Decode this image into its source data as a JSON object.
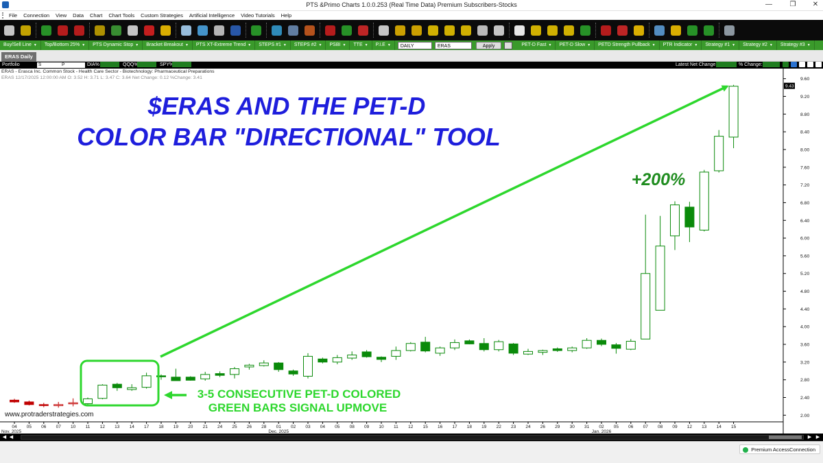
{
  "window": {
    "title": "PTS &Primo Charts 1.0.0.253  (Real Time Data) Premium Subscribers-Stocks",
    "minimize": "—",
    "maximize": "❐",
    "close": "✕"
  },
  "menu": [
    "File",
    "Connection",
    "View",
    "Data",
    "Chart",
    "Chart Tools",
    "Custom Strategies",
    "Artificial Intelligence",
    "Video Tutorials",
    "Help"
  ],
  "toolbar_icons": [
    {
      "name": "bar-chart-icon",
      "color": "#d9d9d9"
    },
    {
      "name": "data-feed-icon",
      "color": "#d6b400"
    },
    {
      "name": "go-green-icon",
      "color": "#2aa02a"
    },
    {
      "name": "red-green-arrows-icon",
      "color": "#c81e1e"
    },
    {
      "name": "trend-lines-icon",
      "color": "#c81e1e"
    },
    {
      "name": "money-icon",
      "color": "#c0a000"
    },
    {
      "name": "volume-bars-icon",
      "color": "#3d9b35"
    },
    {
      "name": "currency-icon",
      "color": "#d9d9d9"
    },
    {
      "name": "delete-red-icon",
      "color": "#d82020"
    },
    {
      "name": "indicator-bars-icon",
      "color": "#f0c000"
    },
    {
      "name": "satellite-icon",
      "color": "#a7d1f3"
    },
    {
      "name": "scanner-icon",
      "color": "#4aa3df"
    },
    {
      "name": "network-icon",
      "color": "#c8c8c8"
    },
    {
      "name": "trend-chart-icon",
      "color": "#2b5fb8"
    },
    {
      "name": "green-bars-icon",
      "color": "#2aa02a"
    },
    {
      "name": "eye-icon",
      "color": "#3399cc"
    },
    {
      "name": "screen-icon",
      "color": "#6a8bb3"
    },
    {
      "name": "eye-red-icon",
      "color": "#c85a1e"
    },
    {
      "name": "candles-red-icon",
      "color": "#c81e1e"
    },
    {
      "name": "candles-mixed-icon",
      "color": "#2aa02a"
    },
    {
      "name": "grid-color-icon",
      "color": "#d02828"
    },
    {
      "name": "save-icon",
      "color": "#d9d9d9"
    },
    {
      "name": "zoom-in-icon",
      "color": "#e0b000"
    },
    {
      "name": "zoom-out-icon",
      "color": "#e0b000"
    },
    {
      "name": "vertical-arrows-icon",
      "color": "#e6c200"
    },
    {
      "name": "scroll-left-icon",
      "color": "#e6c200"
    },
    {
      "name": "scroll-right-icon",
      "color": "#e6c200"
    },
    {
      "name": "draw-line-icon",
      "color": "#cccccc"
    },
    {
      "name": "marker-icon",
      "color": "#d9d9d9"
    },
    {
      "name": "remove-x-icon",
      "color": "#ffffff"
    },
    {
      "name": "crosshair-icon",
      "color": "#e6c200"
    },
    {
      "name": "info-line-icon",
      "color": "#e6c200"
    },
    {
      "name": "pitchfork-icon",
      "color": "#e6c200"
    },
    {
      "name": "candles-green-icon",
      "color": "#2aa02a"
    },
    {
      "name": "arrows-up-down-icon",
      "color": "#c81e1e"
    },
    {
      "name": "pie-circle-icon",
      "color": "#d02828"
    },
    {
      "name": "layout-grid-icon",
      "color": "#f0c000"
    },
    {
      "name": "list-icon",
      "color": "#5b9bd5"
    },
    {
      "name": "refresh-icon",
      "color": "#f0c000"
    },
    {
      "name": "chart-candles-icon",
      "color": "#2aa02a"
    },
    {
      "name": "zigzag-icon",
      "color": "#2aa02a"
    },
    {
      "name": "monitor-icon",
      "color": "#9aa6b0"
    }
  ],
  "strategies": [
    "Buy/Sell Line",
    "Top/Bottom 25%",
    "PTS Dynamic Stop",
    "Bracket Breakout",
    "PTS XT-Extreme Trend",
    "STEPS #1",
    "STEPS #2",
    "PSBI",
    "TTE",
    "P.I.E"
  ],
  "strategies_right": [
    "PET-D Fast",
    "PET-D Slow",
    "PETD Strength Pullback",
    "PTR Indicator",
    "Strategy #1",
    "Strategy #2",
    "Strategy #3"
  ],
  "period_select": "DAILY",
  "symbol_input": "ERAS",
  "apply_label": "Apply",
  "tab_label": "ERAS Daily",
  "portfolio_row": {
    "portfolio_label": "Portfolio",
    "sel1": "S",
    "sel2": "P",
    "dia": "DIA%",
    "qqq": "QQQ%",
    "spy": "SPY%",
    "latest_net": "Latest Net Change:",
    "pct_change": "% Change:"
  },
  "chart_info": {
    "line1": "ERAS - Erasca Inc. Common Stock - Health Care Sector - Biotechnology: Pharmaceutical Preparations",
    "line2": "ERAS 12/17/2025 12:00:00 AM O: 3.52 H: 3.71 L: 3.47 C: 3.64 Net Change: 0.12  %Change: 3.41"
  },
  "annotations": {
    "headline1": "$ERAS AND THE PET-D",
    "headline2": "COLOR BAR \"DIRECTIONAL\" TOOL",
    "gain": "+200%",
    "callout1": "3-5 CONSECUTIVE PET-D COLORED",
    "callout2": "GREEN BARS SIGNAL UPMOVE"
  },
  "watermark": "www.protraderstrategies.com",
  "status": "Premium AccessConnection",
  "colors": {
    "bull_green": "#0a8a0a",
    "bear_red": "#c00000",
    "annotation_blue": "#1e1edc",
    "annotation_green": "#2dd72d",
    "gain_green": "#1f8c1f"
  },
  "chart_data": {
    "type": "candlestick",
    "title": "",
    "price_label": "9.43",
    "ylim": [
      1.85,
      9.75
    ],
    "yticks": [
      2.0,
      2.4,
      2.8,
      3.2,
      3.6,
      4.0,
      4.4,
      4.8,
      5.2,
      5.6,
      6.0,
      6.4,
      6.8,
      7.2,
      7.6,
      8.0,
      8.4,
      8.8,
      9.2,
      9.6
    ],
    "x_labels": [
      "04",
      "05",
      "06",
      "07",
      "10",
      "11",
      "12",
      "13",
      "14",
      "17",
      "18",
      "19",
      "20",
      "21",
      "24",
      "25",
      "26",
      "28",
      "01",
      "02",
      "03",
      "04",
      "05",
      "08",
      "09",
      "10",
      "11",
      "12",
      "15",
      "16",
      "17",
      "18",
      "19",
      "22",
      "23",
      "24",
      "26",
      "29",
      "30",
      "31",
      "02",
      "05",
      "06",
      "07",
      "08",
      "09",
      "12",
      "13",
      "14",
      "15"
    ],
    "month_labels": [
      {
        "label": "Nov. 2025",
        "index": 0
      },
      {
        "label": "Dec. 2025",
        "index": 18
      },
      {
        "label": "Jan. 2026",
        "index": 40
      }
    ],
    "candles": [
      {
        "o": 2.34,
        "h": 2.37,
        "l": 2.28,
        "c": 2.3,
        "color": "red"
      },
      {
        "o": 2.3,
        "h": 2.33,
        "l": 2.22,
        "c": 2.24,
        "color": "red"
      },
      {
        "o": 2.24,
        "h": 2.28,
        "l": 2.18,
        "c": 2.22,
        "color": "red"
      },
      {
        "o": 2.22,
        "h": 2.3,
        "l": 2.17,
        "c": 2.24,
        "color": "red"
      },
      {
        "o": 2.26,
        "h": 2.38,
        "l": 2.2,
        "c": 2.28,
        "color": "red"
      },
      {
        "o": 2.26,
        "h": 2.4,
        "l": 2.23,
        "c": 2.37,
        "color": "green"
      },
      {
        "o": 2.38,
        "h": 2.7,
        "l": 2.36,
        "c": 2.68,
        "color": "green"
      },
      {
        "o": 2.7,
        "h": 2.73,
        "l": 2.55,
        "c": 2.62,
        "color": "green"
      },
      {
        "o": 2.58,
        "h": 2.7,
        "l": 2.55,
        "c": 2.62,
        "color": "green"
      },
      {
        "o": 2.63,
        "h": 2.96,
        "l": 2.6,
        "c": 2.89,
        "color": "green"
      },
      {
        "o": 2.89,
        "h": 2.92,
        "l": 2.8,
        "c": 2.88,
        "color": "green"
      },
      {
        "o": 2.86,
        "h": 3.05,
        "l": 2.78,
        "c": 2.78,
        "color": "green"
      },
      {
        "o": 2.86,
        "h": 2.88,
        "l": 2.78,
        "c": 2.79,
        "color": "green"
      },
      {
        "o": 2.82,
        "h": 2.98,
        "l": 2.78,
        "c": 2.92,
        "color": "green"
      },
      {
        "o": 2.94,
        "h": 2.99,
        "l": 2.86,
        "c": 2.9,
        "color": "green"
      },
      {
        "o": 2.92,
        "h": 3.09,
        "l": 2.83,
        "c": 3.05,
        "color": "green"
      },
      {
        "o": 3.09,
        "h": 3.16,
        "l": 3.03,
        "c": 3.13,
        "color": "green"
      },
      {
        "o": 3.12,
        "h": 3.24,
        "l": 3.1,
        "c": 3.18,
        "color": "green"
      },
      {
        "o": 3.18,
        "h": 3.2,
        "l": 2.98,
        "c": 3.03,
        "color": "green"
      },
      {
        "o": 3.0,
        "h": 3.03,
        "l": 2.89,
        "c": 2.93,
        "color": "green"
      },
      {
        "o": 2.88,
        "h": 3.4,
        "l": 2.83,
        "c": 3.33,
        "color": "green"
      },
      {
        "o": 3.27,
        "h": 3.3,
        "l": 3.17,
        "c": 3.2,
        "color": "green"
      },
      {
        "o": 3.2,
        "h": 3.36,
        "l": 3.15,
        "c": 3.3,
        "color": "green"
      },
      {
        "o": 3.29,
        "h": 3.44,
        "l": 3.25,
        "c": 3.36,
        "color": "green"
      },
      {
        "o": 3.43,
        "h": 3.47,
        "l": 3.3,
        "c": 3.32,
        "color": "green"
      },
      {
        "o": 3.31,
        "h": 3.33,
        "l": 3.2,
        "c": 3.26,
        "color": "green"
      },
      {
        "o": 3.33,
        "h": 3.55,
        "l": 3.25,
        "c": 3.46,
        "color": "green"
      },
      {
        "o": 3.46,
        "h": 3.65,
        "l": 3.44,
        "c": 3.62,
        "color": "green"
      },
      {
        "o": 3.65,
        "h": 3.77,
        "l": 3.42,
        "c": 3.45,
        "color": "green"
      },
      {
        "o": 3.4,
        "h": 3.55,
        "l": 3.34,
        "c": 3.52,
        "color": "green"
      },
      {
        "o": 3.52,
        "h": 3.71,
        "l": 3.47,
        "c": 3.64,
        "color": "green"
      },
      {
        "o": 3.68,
        "h": 3.71,
        "l": 3.6,
        "c": 3.61,
        "color": "green"
      },
      {
        "o": 3.62,
        "h": 3.74,
        "l": 3.44,
        "c": 3.48,
        "color": "green"
      },
      {
        "o": 3.48,
        "h": 3.7,
        "l": 3.44,
        "c": 3.66,
        "color": "green"
      },
      {
        "o": 3.61,
        "h": 3.63,
        "l": 3.36,
        "c": 3.4,
        "color": "green"
      },
      {
        "o": 3.38,
        "h": 3.5,
        "l": 3.36,
        "c": 3.44,
        "color": "green"
      },
      {
        "o": 3.42,
        "h": 3.48,
        "l": 3.36,
        "c": 3.46,
        "color": "green"
      },
      {
        "o": 3.5,
        "h": 3.53,
        "l": 3.43,
        "c": 3.46,
        "color": "green"
      },
      {
        "o": 3.46,
        "h": 3.55,
        "l": 3.42,
        "c": 3.52,
        "color": "green"
      },
      {
        "o": 3.52,
        "h": 3.74,
        "l": 3.5,
        "c": 3.69,
        "color": "green"
      },
      {
        "o": 3.69,
        "h": 3.73,
        "l": 3.56,
        "c": 3.6,
        "color": "green"
      },
      {
        "o": 3.59,
        "h": 3.63,
        "l": 3.39,
        "c": 3.51,
        "color": "green"
      },
      {
        "o": 3.49,
        "h": 3.72,
        "l": 3.47,
        "c": 3.67,
        "color": "green"
      },
      {
        "o": 3.72,
        "h": 6.53,
        "l": 3.72,
        "c": 5.2,
        "color": "green"
      },
      {
        "o": 4.37,
        "h": 6.5,
        "l": 4.37,
        "c": 5.82,
        "color": "green"
      },
      {
        "o": 6.05,
        "h": 6.83,
        "l": 5.73,
        "c": 6.75,
        "color": "green"
      },
      {
        "o": 6.7,
        "h": 6.82,
        "l": 5.91,
        "c": 6.25,
        "color": "green"
      },
      {
        "o": 6.18,
        "h": 7.54,
        "l": 6.15,
        "c": 7.49,
        "color": "green"
      },
      {
        "o": 7.52,
        "h": 8.44,
        "l": 7.48,
        "c": 8.3,
        "color": "green"
      },
      {
        "o": 8.28,
        "h": 9.46,
        "l": 8.03,
        "c": 9.43,
        "color": "green"
      }
    ]
  }
}
